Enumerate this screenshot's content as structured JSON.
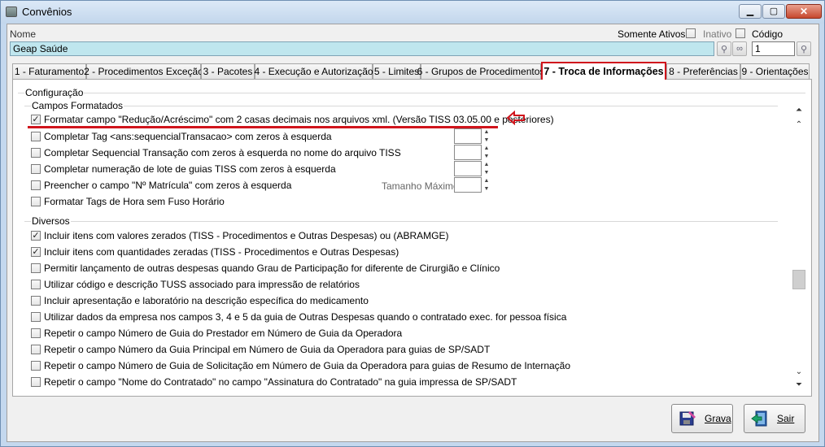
{
  "window": {
    "title": "Convênios"
  },
  "header": {
    "nome_label": "Nome",
    "nome_value": "Geap Saúde",
    "somente_ativos_label": "Somente Ativos",
    "inativo_label": "Inativo",
    "codigo_label": "Código",
    "codigo_value": "1"
  },
  "tabs": [
    {
      "label": "1 - Faturamento"
    },
    {
      "label": "2 - Procedimentos Exceção"
    },
    {
      "label": "3 - Pacotes"
    },
    {
      "label": "4 - Execução e Autorização"
    },
    {
      "label": "5 - Limites"
    },
    {
      "label": "6 - Grupos de Procedimentos"
    },
    {
      "label": "7 - Troca de Informações"
    },
    {
      "label": "8 - Preferências"
    },
    {
      "label": "9 - Orientações"
    }
  ],
  "configuracao": {
    "title": "Configuração",
    "campos_formatados": {
      "title": "Campos Formatados",
      "items": [
        {
          "label": "Formatar campo \"Redução/Acréscimo\" com 2 casas decimais nos arquivos xml.  (Versão TISS 03.05.00 e posteriores)",
          "checked": true
        },
        {
          "label": "Completar Tag <ans:sequencialTransacao> com zeros à esquerda",
          "checked": false
        },
        {
          "label": "Completar Sequencial Transação com zeros à esquerda no nome do arquivo TISS",
          "checked": false
        },
        {
          "label": "Completar numeração de lote de guias TISS com zeros à esquerda",
          "checked": false
        },
        {
          "label": "Preencher o campo \"Nº Matrícula\" com zeros à esquerda",
          "checked": false
        },
        {
          "label": "Formatar Tags de Hora sem Fuso Horário",
          "checked": false
        }
      ],
      "tamanho_maximo_label": "Tamanho Máximo"
    },
    "diversos": {
      "title": "Diversos",
      "items": [
        {
          "label": "Incluir itens com valores zerados (TISS - Procedimentos e Outras Despesas) ou (ABRAMGE)",
          "checked": true
        },
        {
          "label": "Incluir itens com quantidades zeradas (TISS - Procedimentos e Outras Despesas)",
          "checked": true
        },
        {
          "label": "Permitir lançamento de outras despesas quando Grau de Participação for diferente de Cirurgião e Clínico",
          "checked": false
        },
        {
          "label": "Utilizar código e descrição TUSS associado para impressão de relatórios",
          "checked": false
        },
        {
          "label": "Incluir apresentação e laboratório na descrição específica do medicamento",
          "checked": false
        },
        {
          "label": "Utilizar dados da empresa nos campos 3, 4 e 5 da guia de Outras Despesas quando o contratado exec. for pessoa física",
          "checked": false
        },
        {
          "label": "Repetir o campo Número de Guia do Prestador em Número de Guia da Operadora",
          "checked": false
        },
        {
          "label": "Repetir o campo Número da Guia Principal em Número de Guia da Operadora para guias de SP/SADT",
          "checked": false
        },
        {
          "label": "Repetir o campo Número de Guia de Solicitação em Número de Guia da Operadora para guias de Resumo de Internação",
          "checked": false
        },
        {
          "label": "Repetir o campo \"Nome do Contratado\" no campo \"Assinatura do Contratado\" na guia impressa de SP/SADT",
          "checked": false
        }
      ]
    }
  },
  "buttons": {
    "grava_label": "Grava",
    "sair_label": "Sair"
  },
  "colors": {
    "highlight_red": "#d0141c",
    "nome_field_bg": "#bfe6ee",
    "title_bar": "#c2d6ec"
  },
  "icons": {
    "minimize": "minimize-icon",
    "maximize": "maximize-icon",
    "close": "close-icon",
    "search": "search-icon",
    "binoculars": "binoculars-icon",
    "arrow": "left-arrow-icon",
    "save": "save-icon",
    "exit": "exit-icon"
  }
}
